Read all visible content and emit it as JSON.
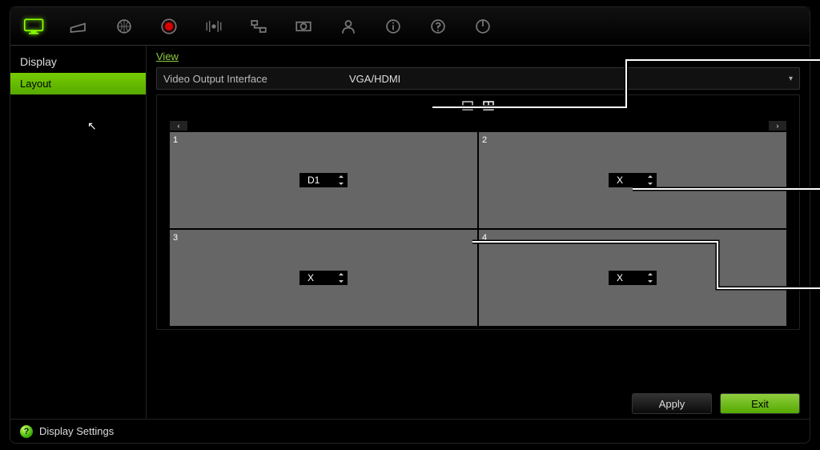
{
  "sidebar": {
    "category": "Display",
    "items": [
      "Layout"
    ],
    "active": 0
  },
  "tab": {
    "name": "View"
  },
  "output": {
    "label": "Video Output Interface",
    "value": "VGA/HDMI"
  },
  "view_modes": {
    "single": "single-view",
    "quad": "quad-view"
  },
  "grid": {
    "cells": [
      {
        "num": "1",
        "value": "D1"
      },
      {
        "num": "2",
        "value": "X"
      },
      {
        "num": "3",
        "value": "X"
      },
      {
        "num": "4",
        "value": "X"
      }
    ]
  },
  "buttons": {
    "apply": "Apply",
    "exit": "Exit"
  },
  "status": {
    "label": "Display Settings"
  }
}
